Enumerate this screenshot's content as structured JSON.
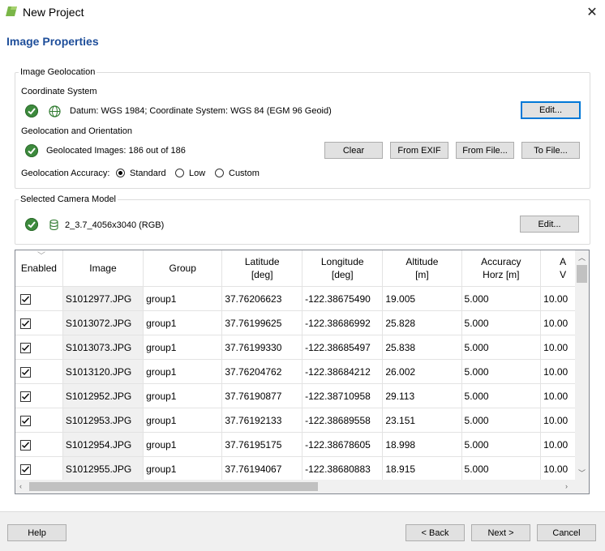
{
  "window": {
    "title": "New Project"
  },
  "page": {
    "title": "Image Properties"
  },
  "geolocation": {
    "group_label": "Image Geolocation",
    "coord_label": "Coordinate System",
    "coord_text": "Datum: WGS 1984; Coordinate System: WGS 84 (EGM 96 Geoid)",
    "coord_edit": "Edit...",
    "geo_label": "Geolocation and Orientation",
    "geo_text": "Geolocated Images: 186 out of 186",
    "buttons": {
      "clear": "Clear",
      "from_exif": "From EXIF",
      "from_file": "From File...",
      "to_file": "To File..."
    },
    "accuracy_label": "Geolocation Accuracy:",
    "accuracy_options": [
      "Standard",
      "Low",
      "Custom"
    ],
    "accuracy_selected": "Standard"
  },
  "camera": {
    "group_label": "Selected Camera Model",
    "model": "2_3.7_4056x3040 (RGB)",
    "edit": "Edit..."
  },
  "table": {
    "headers": [
      "Enabled",
      "Image",
      "Group",
      "Latitude\n[deg]",
      "Longitude\n[deg]",
      "Altitude\n[m]",
      "Accuracy\nHorz [m]",
      "A\nV"
    ],
    "rows": [
      {
        "enabled": true,
        "image": "S1012977.JPG",
        "group": "group1",
        "lat": "37.76206623",
        "lon": "-122.38675490",
        "alt": "19.005",
        "acc_h": "5.000",
        "acc_v": "10.00"
      },
      {
        "enabled": true,
        "image": "S1013072.JPG",
        "group": "group1",
        "lat": "37.76199625",
        "lon": "-122.38686992",
        "alt": "25.828",
        "acc_h": "5.000",
        "acc_v": "10.00"
      },
      {
        "enabled": true,
        "image": "S1013073.JPG",
        "group": "group1",
        "lat": "37.76199330",
        "lon": "-122.38685497",
        "alt": "25.838",
        "acc_h": "5.000",
        "acc_v": "10.00"
      },
      {
        "enabled": true,
        "image": "S1013120.JPG",
        "group": "group1",
        "lat": "37.76204762",
        "lon": "-122.38684212",
        "alt": "26.002",
        "acc_h": "5.000",
        "acc_v": "10.00"
      },
      {
        "enabled": true,
        "image": "S1012952.JPG",
        "group": "group1",
        "lat": "37.76190877",
        "lon": "-122.38710958",
        "alt": "29.113",
        "acc_h": "5.000",
        "acc_v": "10.00"
      },
      {
        "enabled": true,
        "image": "S1012953.JPG",
        "group": "group1",
        "lat": "37.76192133",
        "lon": "-122.38689558",
        "alt": "23.151",
        "acc_h": "5.000",
        "acc_v": "10.00"
      },
      {
        "enabled": true,
        "image": "S1012954.JPG",
        "group": "group1",
        "lat": "37.76195175",
        "lon": "-122.38678605",
        "alt": "18.998",
        "acc_h": "5.000",
        "acc_v": "10.00"
      },
      {
        "enabled": true,
        "image": "S1012955.JPG",
        "group": "group1",
        "lat": "37.76194067",
        "lon": "-122.38680883",
        "alt": "18.915",
        "acc_h": "5.000",
        "acc_v": "10.00"
      }
    ]
  },
  "footer": {
    "help": "Help",
    "back": "< Back",
    "next": "Next >",
    "cancel": "Cancel"
  },
  "colors": {
    "title_blue": "#1e4e9a",
    "ok_green": "#3d8a3d",
    "focus_blue": "#0078d7"
  },
  "icons": {
    "status": "check-circle-icon",
    "globe": "globe-icon",
    "camera_db": "database-icon",
    "app": "pix4d-leaf-icon"
  }
}
